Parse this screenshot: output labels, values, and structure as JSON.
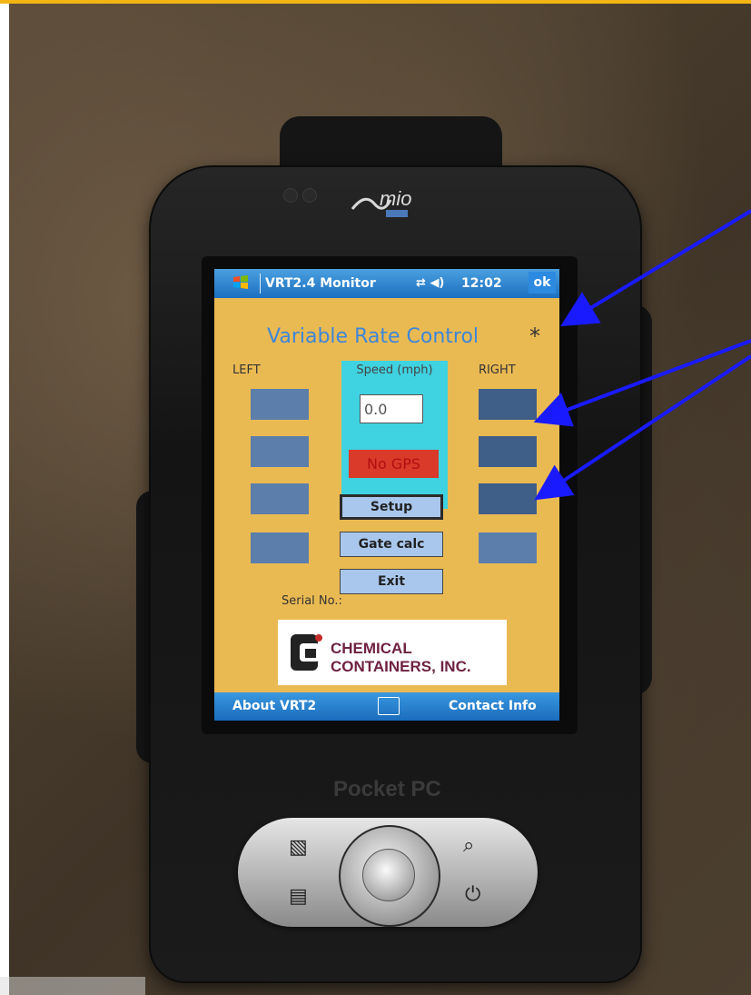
{
  "titlebar": {
    "app_title": "VRT2.4 Monitor",
    "clock": "12:02",
    "ok_label": "ok",
    "icons": [
      "start-logo-icon",
      "connectivity-icon",
      "volume-icon"
    ]
  },
  "main": {
    "heading": "Variable Rate Control",
    "indicator": "*",
    "left_label": "LEFT",
    "right_label": "RIGHT",
    "speed_label": "Speed (mph)",
    "speed_value": "0.0",
    "gps_status": "No GPS",
    "buttons": {
      "setup": "Setup",
      "gate_calc": "Gate calc",
      "exit": "Exit"
    },
    "serial_label": "Serial No.:",
    "logo": {
      "line1": "CHEMICAL",
      "line2": "CONTAINERS, INC."
    }
  },
  "menubar": {
    "left": "About VRT2",
    "right": "Contact Info",
    "center_icon": "keyboard-icon"
  },
  "device": {
    "brand": "mio",
    "model_label": "Pocket PC",
    "hardware_icons": [
      "map-icon",
      "search-icon",
      "calendar-icon",
      "power-icon"
    ]
  },
  "colors": {
    "screen_bg": "#eaba52",
    "title_bar": "#1c6fc0",
    "heading": "#3e86d9",
    "panel": "#3fd2e0",
    "gps_alert": "#d93a2a",
    "button": "#a9c7ec",
    "annotation_arrow": "#1a1aff",
    "page_top_rule": "#f2b514"
  }
}
